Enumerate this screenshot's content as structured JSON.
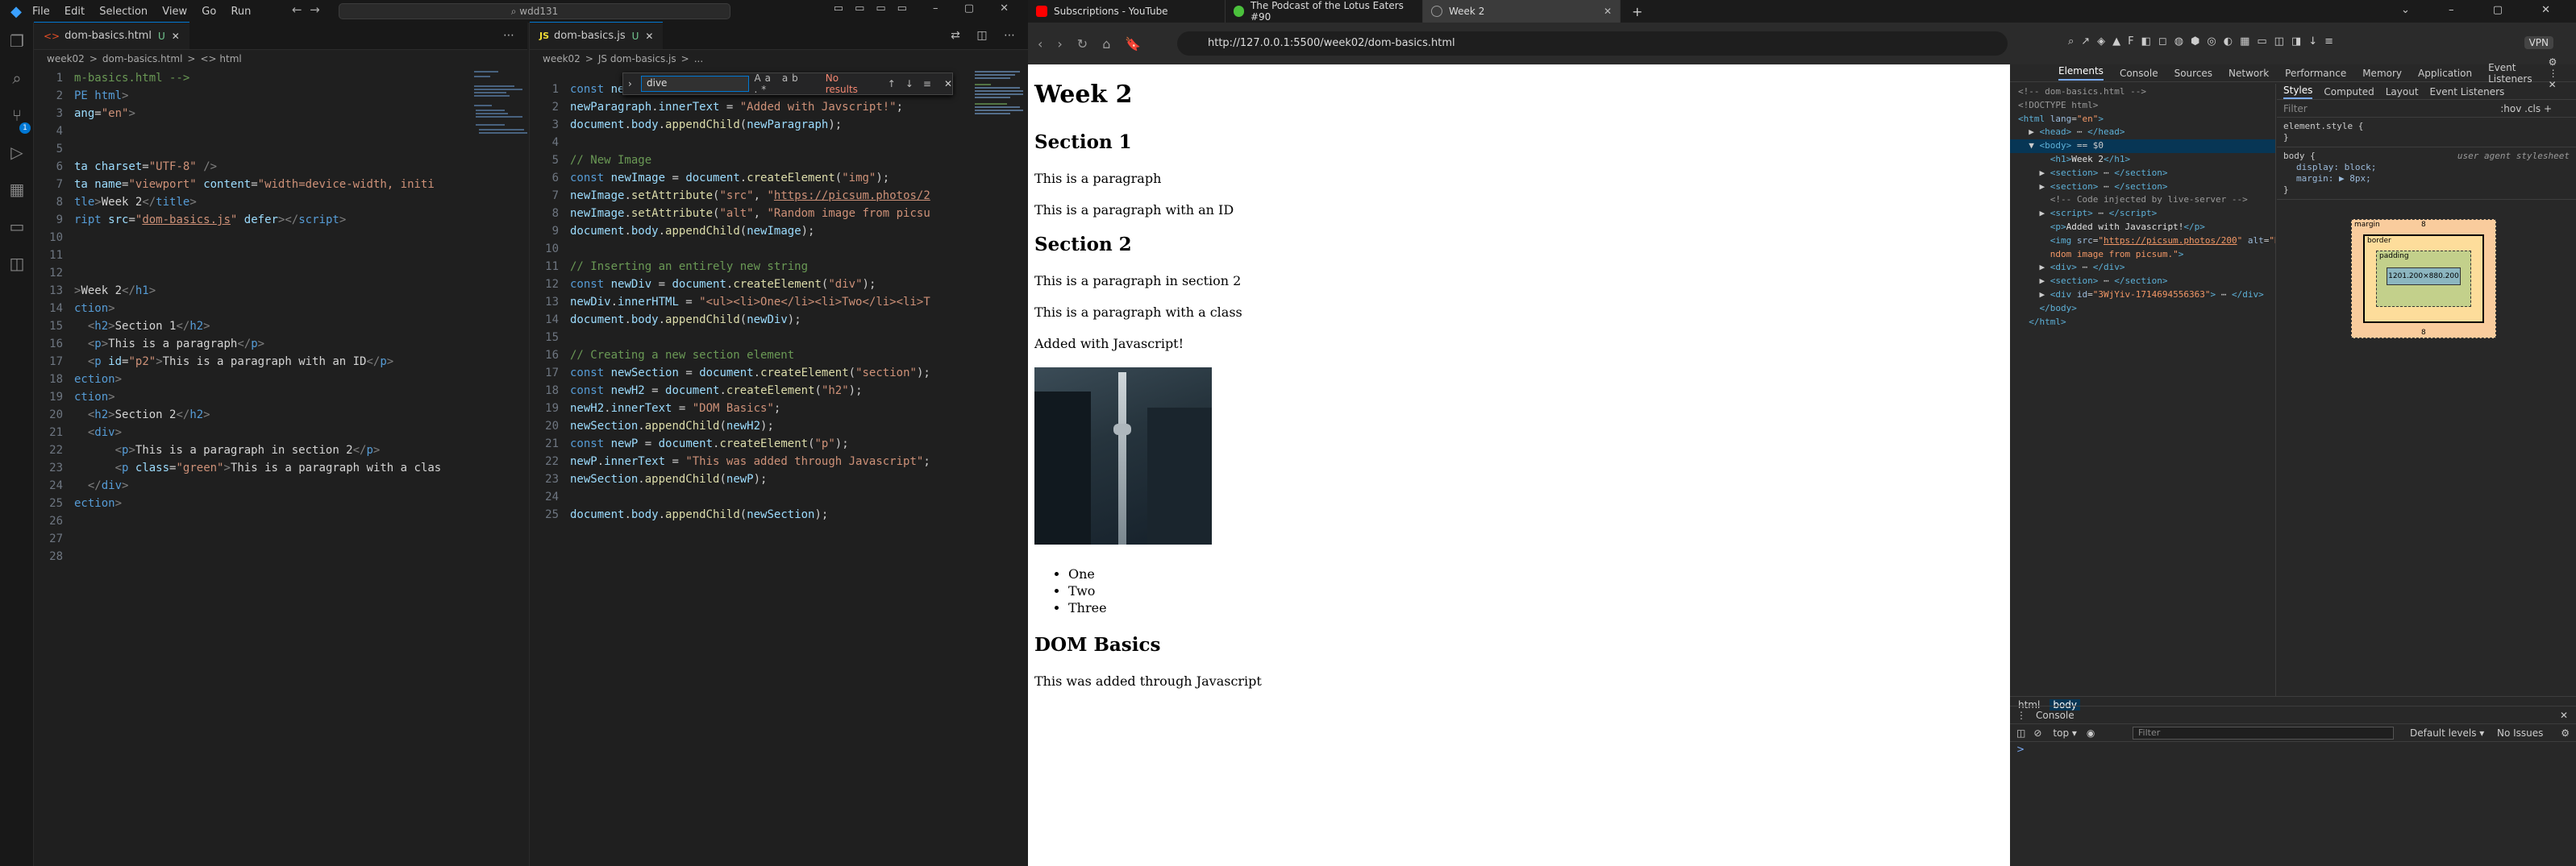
{
  "vscode": {
    "menu": [
      "File",
      "Edit",
      "Selection",
      "View",
      "Go",
      "Run"
    ],
    "search": "wdd131",
    "left": {
      "tab": "dom-basics.html",
      "tab_status": "U",
      "crumbs": [
        "week02",
        ">",
        "dom-basics.html",
        ">",
        "<> html"
      ],
      "lines": [
        {
          "n": "1",
          "h": "<span class='com'>m-basics.html --&gt;</span>"
        },
        {
          "n": "2",
          "h": "<span class='tag'>PE html</span><span class='pun'>&gt;</span>"
        },
        {
          "n": "3",
          "h": "<span class='attr'>ang</span>=<span class='str'>\"en\"</span><span class='pun'>&gt;</span>"
        },
        {
          "n": "4",
          "h": ""
        },
        {
          "n": "5",
          "h": ""
        },
        {
          "n": "6",
          "h": "<span class='attr'>ta charset</span>=<span class='str'>\"UTF-8\"</span> <span class='pun'>/&gt;</span>"
        },
        {
          "n": "7",
          "h": "<span class='attr'>ta name</span>=<span class='str'>\"viewport\"</span> <span class='attr'>content</span>=<span class='str'>\"width=device-width, initi</span>"
        },
        {
          "n": "8",
          "h": "<span class='tag'>tle</span><span class='pun'>&gt;</span><span class='txt'>Week 2</span><span class='pun'>&lt;/</span><span class='tag'>title</span><span class='pun'>&gt;</span>"
        },
        {
          "n": "9",
          "h": "<span class='tag'>ript</span> <span class='attr'>src</span>=<span class='str'>\"<u>dom-basics.js</u>\"</span> <span class='attr'>defer</span><span class='pun'>&gt;&lt;/</span><span class='tag'>script</span><span class='pun'>&gt;</span>"
        },
        {
          "n": "10",
          "h": ""
        },
        {
          "n": "11",
          "h": ""
        },
        {
          "n": "12",
          "h": ""
        },
        {
          "n": "13",
          "h": "<span class='pun'>&gt;</span><span class='txt'>Week 2</span><span class='pun'>&lt;/</span><span class='tag'>h1</span><span class='pun'>&gt;</span>"
        },
        {
          "n": "14",
          "h": "<span class='tag'>ction</span><span class='pun'>&gt;</span>"
        },
        {
          "n": "15",
          "h": "  <span class='pun'>&lt;</span><span class='tag'>h2</span><span class='pun'>&gt;</span><span class='txt'>Section 1</span><span class='pun'>&lt;/</span><span class='tag'>h2</span><span class='pun'>&gt;</span>"
        },
        {
          "n": "16",
          "h": "  <span class='pun'>&lt;</span><span class='tag'>p</span><span class='pun'>&gt;</span><span class='txt'>This is a paragraph</span><span class='pun'>&lt;/</span><span class='tag'>p</span><span class='pun'>&gt;</span>"
        },
        {
          "n": "17",
          "h": "  <span class='pun'>&lt;</span><span class='tag'>p</span> <span class='attr'>id</span>=<span class='str'>\"p2\"</span><span class='pun'>&gt;</span><span class='txt'>This is a paragraph with an ID</span><span class='pun'>&lt;/</span><span class='tag'>p</span><span class='pun'>&gt;</span>"
        },
        {
          "n": "18",
          "h": "<span class='tag'>ection</span><span class='pun'>&gt;</span>"
        },
        {
          "n": "19",
          "h": "<span class='tag'>ction</span><span class='pun'>&gt;</span>"
        },
        {
          "n": "20",
          "h": "  <span class='pun'>&lt;</span><span class='tag'>h2</span><span class='pun'>&gt;</span><span class='txt'>Section 2</span><span class='pun'>&lt;/</span><span class='tag'>h2</span><span class='pun'>&gt;</span>"
        },
        {
          "n": "21",
          "h": "  <span class='pun'>&lt;</span><span class='tag'>div</span><span class='pun'>&gt;</span>"
        },
        {
          "n": "22",
          "h": "      <span class='pun'>&lt;</span><span class='tag'>p</span><span class='pun'>&gt;</span><span class='txt'>This is a paragraph in section 2</span><span class='pun'>&lt;/</span><span class='tag'>p</span><span class='pun'>&gt;</span>"
        },
        {
          "n": "23",
          "h": "      <span class='pun'>&lt;</span><span class='tag'>p</span> <span class='attr'>class</span>=<span class='str'>\"green\"</span><span class='pun'>&gt;</span><span class='txt'>This is a paragraph with a clas</span>"
        },
        {
          "n": "24",
          "h": "  <span class='pun'>&lt;/</span><span class='tag'>div</span><span class='pun'>&gt;</span>"
        },
        {
          "n": "25",
          "h": "<span class='tag'>ection</span><span class='pun'>&gt;</span>"
        },
        {
          "n": "26",
          "h": ""
        },
        {
          "n": "27",
          "h": ""
        },
        {
          "n": "28",
          "h": ""
        }
      ]
    },
    "right": {
      "tab": "dom-basics.js",
      "tab_status": "U",
      "crumbs": [
        "week02",
        ">",
        "JS dom-basics.js",
        ">",
        "..."
      ],
      "find": {
        "query": "dive",
        "options": "Aa ab .*",
        "result": "No results"
      },
      "lines": [
        {
          "n": "1",
          "h": "<span class='kw'>const</span> <span class='var'>newParagraph</span> = <span class='var'>document</span>.<span class='fn'>createElement</span>(<span class='str'>\"p\"</span>);"
        },
        {
          "n": "2",
          "h": "<span class='var'>newParagraph</span>.<span class='var'>innerText</span> = <span class='str'>\"Added with Javscript!\"</span>;"
        },
        {
          "n": "3",
          "h": "<span class='var'>document</span>.<span class='var'>body</span>.<span class='fn'>appendChild</span>(<span class='var'>newParagraph</span>);"
        },
        {
          "n": "4",
          "h": ""
        },
        {
          "n": "5",
          "h": "<span class='com'>// New Image</span>"
        },
        {
          "n": "6",
          "h": "<span class='kw'>const</span> <span class='var'>newImage</span> = <span class='var'>document</span>.<span class='fn'>createElement</span>(<span class='str'>\"img\"</span>);"
        },
        {
          "n": "7",
          "h": "<span class='var'>newImage</span>.<span class='fn'>setAttribute</span>(<span class='str'>\"src\"</span>, <span class='str'>\"<u>https://picsum.photos/2</u></span>"
        },
        {
          "n": "8",
          "h": "<span class='var'>newImage</span>.<span class='fn'>setAttribute</span>(<span class='str'>\"alt\"</span>, <span class='str'>\"Random image from picsu</span>"
        },
        {
          "n": "9",
          "h": "<span class='var'>document</span>.<span class='var'>body</span>.<span class='fn'>appendChild</span>(<span class='var'>newImage</span>);"
        },
        {
          "n": "10",
          "h": ""
        },
        {
          "n": "11",
          "h": "<span class='com'>// Inserting an entirely new string</span>"
        },
        {
          "n": "12",
          "h": "<span class='kw'>const</span> <span class='var'>newDiv</span> = <span class='var'>document</span>.<span class='fn'>createElement</span>(<span class='str'>\"div\"</span>);"
        },
        {
          "n": "13",
          "h": "<span class='var'>newDiv</span>.<span class='var'>innerHTML</span> = <span class='str'>\"&lt;ul&gt;&lt;li&gt;One&lt;/li&gt;&lt;li&gt;Two&lt;/li&gt;&lt;li&gt;T</span>"
        },
        {
          "n": "14",
          "h": "<span class='var'>document</span>.<span class='var'>body</span>.<span class='fn'>appendChild</span>(<span class='var'>newDiv</span>);"
        },
        {
          "n": "15",
          "h": ""
        },
        {
          "n": "16",
          "h": "<span class='com'>// Creating a new section element</span>"
        },
        {
          "n": "17",
          "h": "<span class='kw'>const</span> <span class='var'>newSection</span> = <span class='var'>document</span>.<span class='fn'>createElement</span>(<span class='str'>\"section\"</span>);"
        },
        {
          "n": "18",
          "h": "<span class='kw'>const</span> <span class='var'>newH2</span> = <span class='var'>document</span>.<span class='fn'>createElement</span>(<span class='str'>\"h2\"</span>);"
        },
        {
          "n": "19",
          "h": "<span class='var'>newH2</span>.<span class='var'>innerText</span> = <span class='str'>\"DOM Basics\"</span>;"
        },
        {
          "n": "20",
          "h": "<span class='var'>newSection</span>.<span class='fn'>appendChild</span>(<span class='var'>newH2</span>);"
        },
        {
          "n": "21",
          "h": "<span class='kw'>const</span> <span class='var'>newP</span> = <span class='var'>document</span>.<span class='fn'>createElement</span>(<span class='str'>\"p\"</span>);"
        },
        {
          "n": "22",
          "h": "<span class='var'>newP</span>.<span class='var'>innerText</span> = <span class='str'>\"This was added through Javascript\"</span>;"
        },
        {
          "n": "23",
          "h": "<span class='var'>newSection</span>.<span class='fn'>appendChild</span>(<span class='var'>newP</span>);"
        },
        {
          "n": "24",
          "h": ""
        },
        {
          "n": "25",
          "h": "<span class='var'>document</span>.<span class='var'>body</span>.<span class='fn'>appendChild</span>(<span class='var'>newSection</span>);"
        }
      ]
    }
  },
  "browser": {
    "tabs": [
      {
        "title": "Subscriptions - YouTube",
        "color": "#ff0000"
      },
      {
        "title": "The Podcast of the Lotus Eaters #90",
        "color": "#4bc13c"
      },
      {
        "title": "Week 2",
        "color": "#888888"
      }
    ],
    "url": "http://127.0.0.1:5500/week02/dom-basics.html",
    "vpn": "VPN",
    "page": {
      "h1": "Week 2",
      "s1_h2": "Section 1",
      "s1_p1": "This is a paragraph",
      "s1_p2": "This is a paragraph with an ID",
      "s2_h2": "Section 2",
      "s2_p1": "This is a paragraph in section 2",
      "s2_p2": "This is a paragraph with a class",
      "added": "Added with Javascript!",
      "list": [
        "One",
        "Two",
        "Three"
      ],
      "dom_h2": "DOM Basics",
      "dom_p": "This was added through Javascript"
    },
    "devtools": {
      "tabs": [
        "Elements",
        "Console",
        "Sources",
        "Network",
        "Performance",
        "Memory",
        "Application",
        "Event Listeners"
      ],
      "dom_lines": [
        "<span class='dt-cm'>&lt;!-- dom-basics.html --&gt;</span>",
        "<span class='dt-cm'>&lt;!DOCTYPE html&gt;</span>",
        "<span class='dt-tag'>&lt;html</span> <span class='dt-at'>lang</span>=<span class='dt-av'>\"en\"</span><span class='dt-tag'>&gt;</span>",
        "  ▶ <span class='dt-tag'>&lt;head&gt;</span> ⋯ <span class='dt-tag'>&lt;/head&gt;</span>",
        "  ▼ <span class='dt-tag'>&lt;body&gt;</span> == $0",
        "      <span class='dt-tag'>&lt;h1&gt;</span><span class='dt-tx'>Week 2</span><span class='dt-tag'>&lt;/h1&gt;</span>",
        "    ▶ <span class='dt-tag'>&lt;section&gt;</span> ⋯ <span class='dt-tag'>&lt;/section&gt;</span>",
        "    ▶ <span class='dt-tag'>&lt;section&gt;</span> ⋯ <span class='dt-tag'>&lt;/section&gt;</span>",
        "      <span class='dt-cm'>&lt;!-- Code injected by live-server --&gt;</span>",
        "    ▶ <span class='dt-tag'>&lt;script&gt;</span> ⋯ <span class='dt-tag'>&lt;/script&gt;</span>",
        "      <span class='dt-tag'>&lt;p&gt;</span><span class='dt-tx'>Added with Javascript!</span><span class='dt-tag'>&lt;/p&gt;</span>",
        "      <span class='dt-tag'>&lt;img</span> <span class='dt-at'>src</span>=<span class='dt-av'>\"<u>https://picsum.photos/200</u>\"</span> <span class='dt-at'>alt</span>=<span class='dt-av'>\"Ra</span>",
        "      <span class='dt-av'>ndom image from picsum.\"</span><span class='dt-tag'>&gt;</span>",
        "    ▶ <span class='dt-tag'>&lt;div&gt;</span> ⋯ <span class='dt-tag'>&lt;/div&gt;</span>",
        "    ▶ <span class='dt-tag'>&lt;section&gt;</span> ⋯ <span class='dt-tag'>&lt;/section&gt;</span>",
        "    ▶ <span class='dt-tag'>&lt;div</span> <span class='dt-at'>id</span>=<span class='dt-av'>\"3WjYiv-1714694556363\"</span><span class='dt-tag'>&gt;</span> ⋯ <span class='dt-tag'>&lt;/div&gt;</span>",
        "    <span class='dt-tag'>&lt;/body&gt;</span>",
        "  <span class='dt-tag'>&lt;/html&gt;</span>"
      ],
      "style_tabs": [
        "Styles",
        "Computed",
        "Layout",
        "Event Listeners"
      ],
      "filter": "Filter",
      "filter_tools": ":hov  .cls  +",
      "element_style": "element.style {",
      "close_brace": "}",
      "ua_label": "user agent stylesheet",
      "body_rule": "body {",
      "prop1": "display: block;",
      "prop2": "margin: ▶ 8px;",
      "box": {
        "margin": "margin",
        "border": "border",
        "padding": "padding",
        "content": "1201.200×880.200",
        "m": "8",
        "dash": "-"
      },
      "crumbs": [
        "html",
        "body"
      ],
      "console_title": "Console",
      "console_ctx": "top ▾",
      "console_filter": "Filter",
      "levels": "Default levels ▾",
      "issues": "No Issues",
      "prompt": ">"
    }
  }
}
